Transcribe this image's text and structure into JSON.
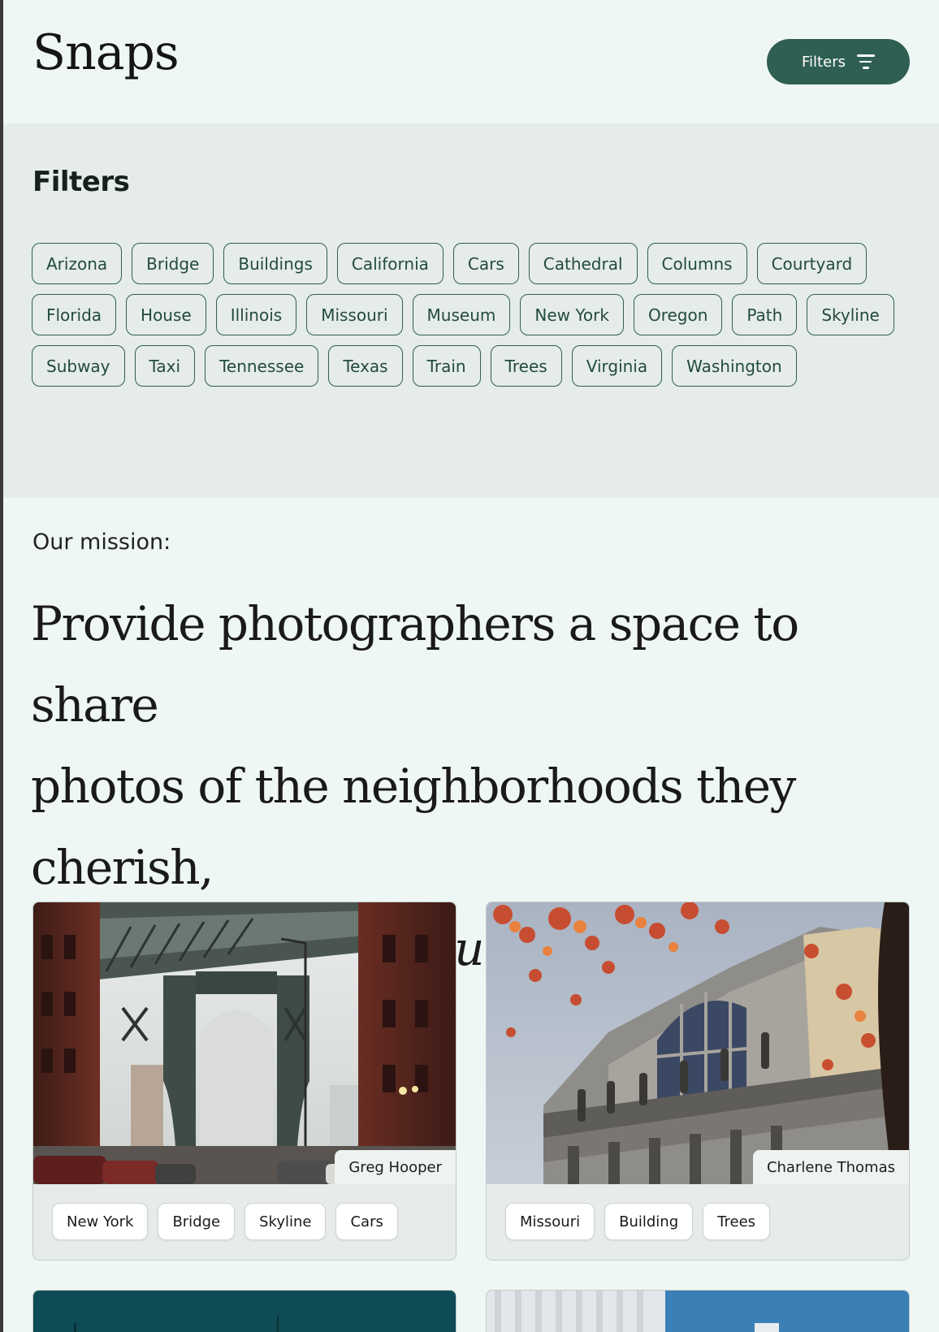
{
  "header": {
    "brand": "Snaps",
    "filters_button": "Filters"
  },
  "filter_panel": {
    "title": "Filters",
    "rows": [
      [
        "Arizona",
        "Bridge",
        "Buildings",
        "California",
        "Cars",
        "Cathedral",
        "Columns",
        "Courtyard"
      ],
      [
        "Florida",
        "House",
        "Illinois",
        "Missouri",
        "Museum",
        "New York",
        "Oregon",
        "Path",
        "Skyline"
      ],
      [
        "Subway",
        "Taxi",
        "Tennessee",
        "Texas",
        "Train",
        "Trees",
        "Virginia",
        "Washington"
      ]
    ]
  },
  "mission": {
    "label": "Our mission:",
    "line1": "Provide photographers a space to share",
    "line2": "photos of the neighborhoods they cherish,",
    "line3_italic": "expressed in their unique style."
  },
  "cards": [
    {
      "photographer": "Greg Hooper",
      "tags": [
        "New York",
        "Bridge",
        "Skyline",
        "Cars"
      ]
    },
    {
      "photographer": "Charlene Thomas",
      "tags": [
        "Missouri",
        "Building",
        "Trees"
      ]
    }
  ],
  "colors": {
    "page_bg": "#eef7f3",
    "panel_bg": "#e5ece9",
    "accent": "#2f5f52"
  }
}
